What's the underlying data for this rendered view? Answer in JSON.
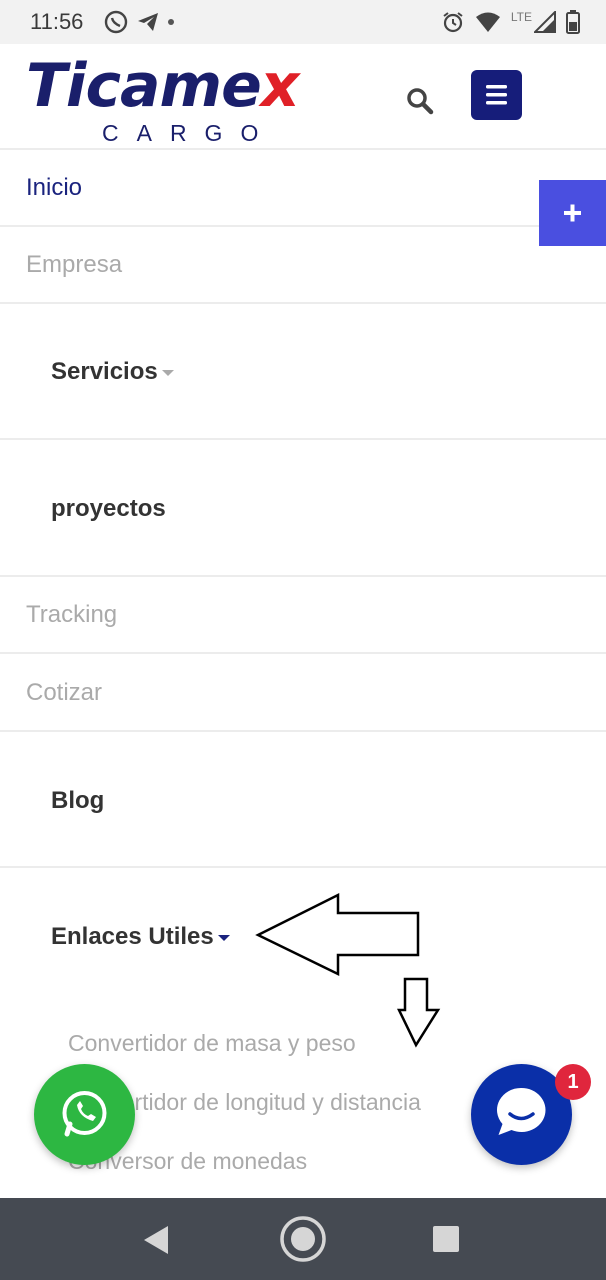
{
  "status_bar": {
    "time": "11:56",
    "left_icons": [
      "whatsapp-icon",
      "telegram-icon",
      "notification-dot"
    ],
    "right_icons": [
      "alarm-icon",
      "wifi-icon",
      "lte-signal-icon",
      "battery-icon"
    ],
    "network_label": "LTE"
  },
  "header": {
    "logo_main_prefix": "Ticame",
    "logo_main_x": "x",
    "logo_sub": "CARGO",
    "brand_navy": "#1a1f6b",
    "brand_red": "#e02027"
  },
  "menu": {
    "items": [
      {
        "label": "Inicio"
      },
      {
        "label": "Empresa"
      },
      {
        "label": "Servicios"
      },
      {
        "label": "proyectos"
      },
      {
        "label": "Tracking"
      },
      {
        "label": "Cotizar"
      },
      {
        "label": "Blog"
      },
      {
        "label": "Enlaces Utiles"
      }
    ],
    "sub_links": [
      {
        "label": "Convertidor de masa y peso"
      },
      {
        "label": "Convertidor de longitud y distancia"
      },
      {
        "label": "Conversor de monedas"
      }
    ]
  },
  "chat": {
    "badge_count": "1"
  },
  "colors": {
    "accent_blue": "#4a4fe0",
    "menu_button": "#161d7a",
    "whatsapp_green": "#2db742",
    "chat_blue": "#0a2fa8",
    "badge_red": "#e0263d"
  }
}
